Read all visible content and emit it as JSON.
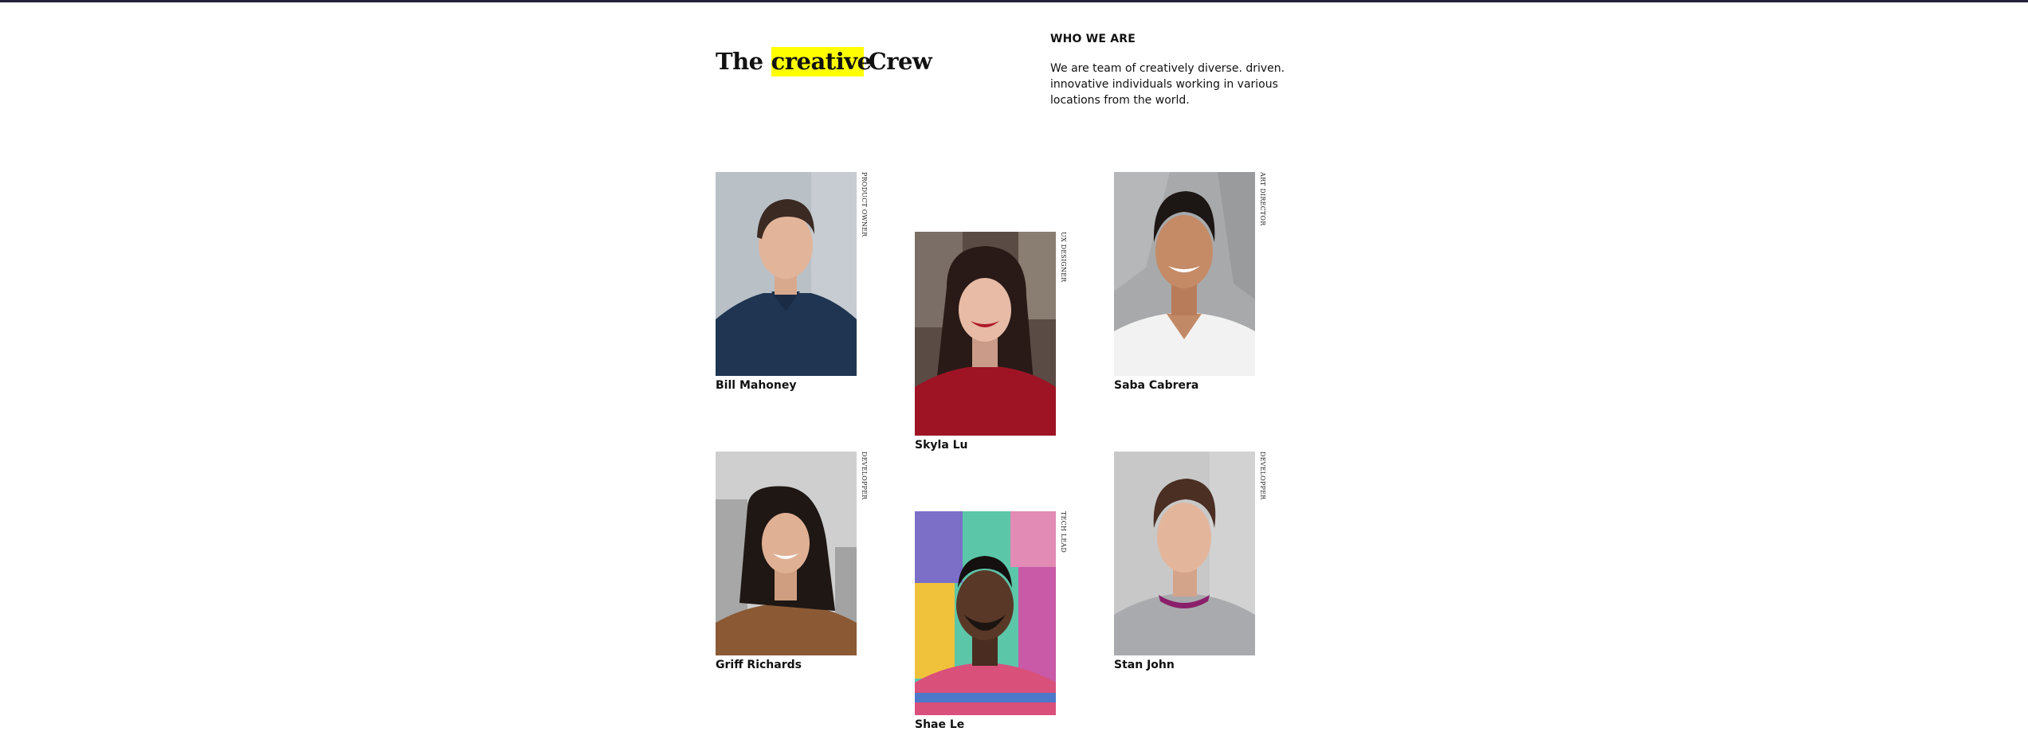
{
  "header": {
    "title_before": "The",
    "title_highlight": "creative",
    "title_after": "Crew",
    "highlight_color": "#ffff00"
  },
  "about": {
    "heading": "WHO WE ARE",
    "text": "We are team of creatively diverse. driven. innovative individuals working in various locations from the world."
  },
  "team": [
    {
      "name": "Bill Mahoney",
      "role": "PRODUCT OWNER"
    },
    {
      "name": "Skyla Lu",
      "role": "UX DESIGNER"
    },
    {
      "name": "Saba Cabrera",
      "role": "ART DIRECTOR"
    },
    {
      "name": "Griff Richards",
      "role": "DEVELOPPER"
    },
    {
      "name": "Shae Le",
      "role": "TECH LEAD"
    },
    {
      "name": "Stan John",
      "role": "DEVELOPPER"
    }
  ]
}
